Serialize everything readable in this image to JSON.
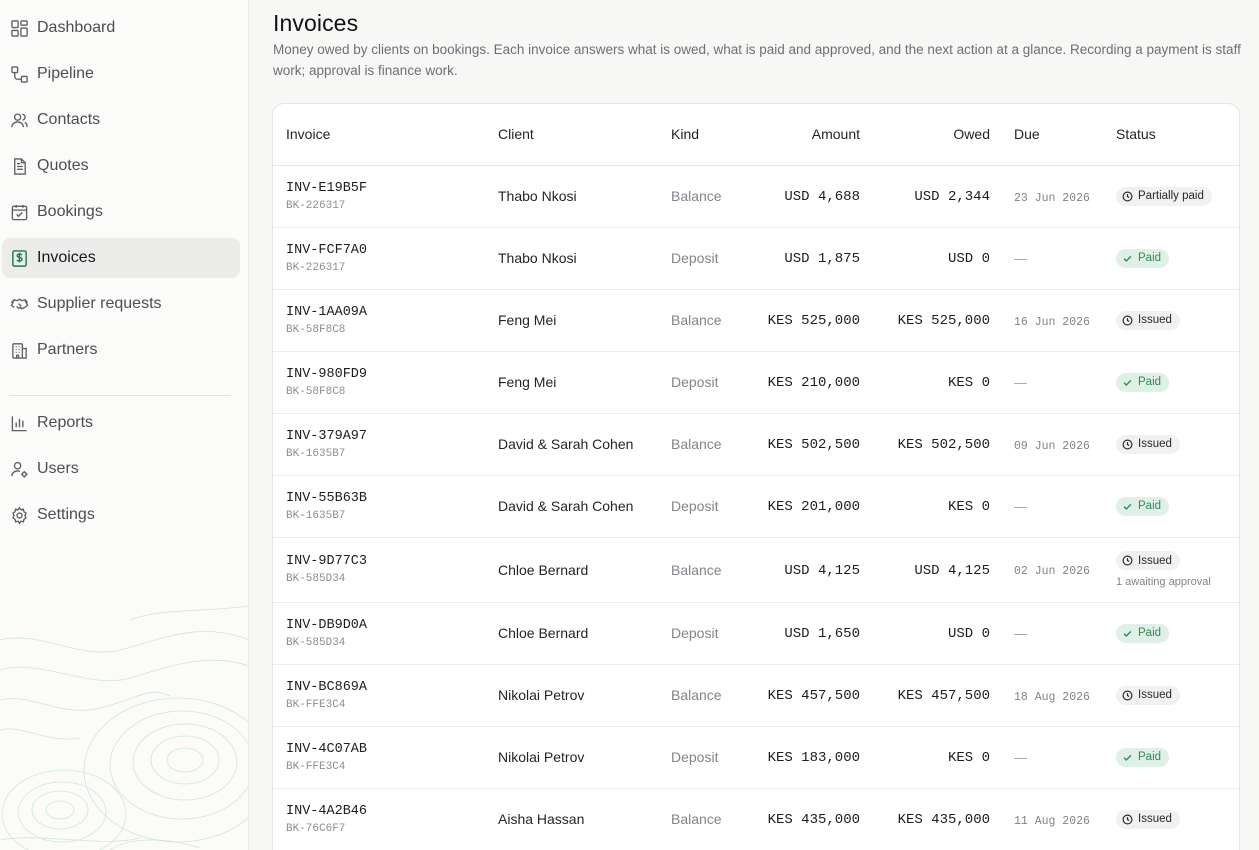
{
  "sidebar": {
    "items": [
      {
        "label": "Dashboard",
        "icon": "dashboard-icon",
        "active": false
      },
      {
        "label": "Pipeline",
        "icon": "pipeline-icon",
        "active": false
      },
      {
        "label": "Contacts",
        "icon": "contacts-icon",
        "active": false
      },
      {
        "label": "Quotes",
        "icon": "quotes-icon",
        "active": false
      },
      {
        "label": "Bookings",
        "icon": "calendar-check-icon",
        "active": false
      },
      {
        "label": "Invoices",
        "icon": "dollar-receipt-icon",
        "active": true
      },
      {
        "label": "Supplier requests",
        "icon": "handshake-icon",
        "active": false
      },
      {
        "label": "Partners",
        "icon": "building-icon",
        "active": false
      },
      {
        "label": "Reports",
        "icon": "bar-chart-icon",
        "active": false
      },
      {
        "label": "Users",
        "icon": "user-gear-icon",
        "active": false
      },
      {
        "label": "Settings",
        "icon": "gear-icon",
        "active": false
      }
    ]
  },
  "page": {
    "title": "Invoices",
    "description": "Money owed by clients on bookings. Each invoice answers what is owed, what is paid and approved, and the next action at a glance. Recording a payment is staff work; approval is finance work."
  },
  "table": {
    "columns": {
      "invoice": "Invoice",
      "client": "Client",
      "kind": "Kind",
      "amount": "Amount",
      "owed": "Owed",
      "due": "Due",
      "status": "Status"
    },
    "rows": [
      {
        "invoice": "INV-E19B5F",
        "booking": "BK-226317",
        "client": "Thabo Nkosi",
        "kind": "Balance",
        "amount": "USD 4,688",
        "owed": "USD 2,344",
        "due": "23 Jun 2026",
        "status": "Partially paid",
        "status_type": "partial",
        "note": ""
      },
      {
        "invoice": "INV-FCF7A0",
        "booking": "BK-226317",
        "client": "Thabo Nkosi",
        "kind": "Deposit",
        "amount": "USD 1,875",
        "owed": "USD 0",
        "due": "—",
        "status": "Paid",
        "status_type": "paid",
        "note": ""
      },
      {
        "invoice": "INV-1AA09A",
        "booking": "BK-58F8C8",
        "client": "Feng Mei",
        "kind": "Balance",
        "amount": "KES 525,000",
        "owed": "KES 525,000",
        "due": "16 Jun 2026",
        "status": "Issued",
        "status_type": "issued",
        "note": ""
      },
      {
        "invoice": "INV-980FD9",
        "booking": "BK-58F8C8",
        "client": "Feng Mei",
        "kind": "Deposit",
        "amount": "KES 210,000",
        "owed": "KES 0",
        "due": "—",
        "status": "Paid",
        "status_type": "paid",
        "note": ""
      },
      {
        "invoice": "INV-379A97",
        "booking": "BK-1635B7",
        "client": "David & Sarah Cohen",
        "kind": "Balance",
        "amount": "KES 502,500",
        "owed": "KES 502,500",
        "due": "09 Jun 2026",
        "status": "Issued",
        "status_type": "issued",
        "note": ""
      },
      {
        "invoice": "INV-55B63B",
        "booking": "BK-1635B7",
        "client": "David & Sarah Cohen",
        "kind": "Deposit",
        "amount": "KES 201,000",
        "owed": "KES 0",
        "due": "—",
        "status": "Paid",
        "status_type": "paid",
        "note": ""
      },
      {
        "invoice": "INV-9D77C3",
        "booking": "BK-585D34",
        "client": "Chloe Bernard",
        "kind": "Balance",
        "amount": "USD 4,125",
        "owed": "USD 4,125",
        "due": "02 Jun 2026",
        "status": "Issued",
        "status_type": "issued",
        "note": "1 awaiting approval"
      },
      {
        "invoice": "INV-DB9D0A",
        "booking": "BK-585D34",
        "client": "Chloe Bernard",
        "kind": "Deposit",
        "amount": "USD 1,650",
        "owed": "USD 0",
        "due": "—",
        "status": "Paid",
        "status_type": "paid",
        "note": ""
      },
      {
        "invoice": "INV-BC869A",
        "booking": "BK-FFE3C4",
        "client": "Nikolai Petrov",
        "kind": "Balance",
        "amount": "KES 457,500",
        "owed": "KES 457,500",
        "due": "18 Aug 2026",
        "status": "Issued",
        "status_type": "issued",
        "note": ""
      },
      {
        "invoice": "INV-4C07AB",
        "booking": "BK-FFE3C4",
        "client": "Nikolai Petrov",
        "kind": "Deposit",
        "amount": "KES 183,000",
        "owed": "KES 0",
        "due": "—",
        "status": "Paid",
        "status_type": "paid",
        "note": ""
      },
      {
        "invoice": "INV-4A2B46",
        "booking": "BK-76C6F7",
        "client": "Aisha Hassan",
        "kind": "Balance",
        "amount": "KES 435,000",
        "owed": "KES 435,000",
        "due": "11 Aug 2026",
        "status": "Issued",
        "status_type": "issued",
        "note": ""
      }
    ]
  },
  "colors": {
    "accent_green": "#2f8a57",
    "paid_badge_bg": "#dff0e6",
    "active_nav_bg": "#ececea"
  }
}
